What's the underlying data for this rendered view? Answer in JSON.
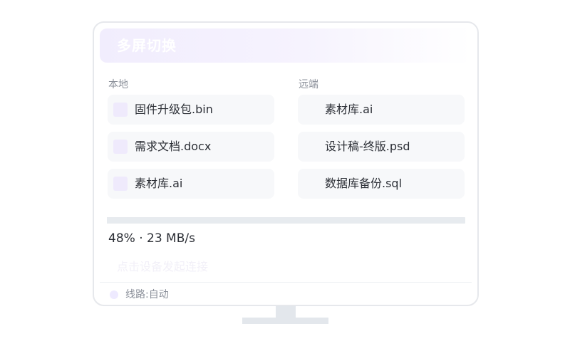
{
  "window": {
    "title": "多屏切换"
  },
  "local": {
    "label": "本地",
    "files": [
      {
        "name": "固件升级包.bin"
      },
      {
        "name": "需求文档.docx"
      },
      {
        "name": "素材库.ai"
      }
    ]
  },
  "remote": {
    "label": "远端",
    "files": [
      {
        "name": "素材库.ai"
      },
      {
        "name": "设计稿-终版.psd"
      },
      {
        "name": "数据库备份.sql"
      }
    ]
  },
  "transfer": {
    "progress_percent": 48,
    "status_text": "48% · 23 MB/s"
  },
  "hint": "点击设备发起连接",
  "route": {
    "label": "线路:自动"
  },
  "colors": {
    "accent_light": "#f1edfd",
    "file_icon": "#efeafc",
    "card_bg": "#f7f8fa",
    "progress_track": "#e7ebef"
  }
}
